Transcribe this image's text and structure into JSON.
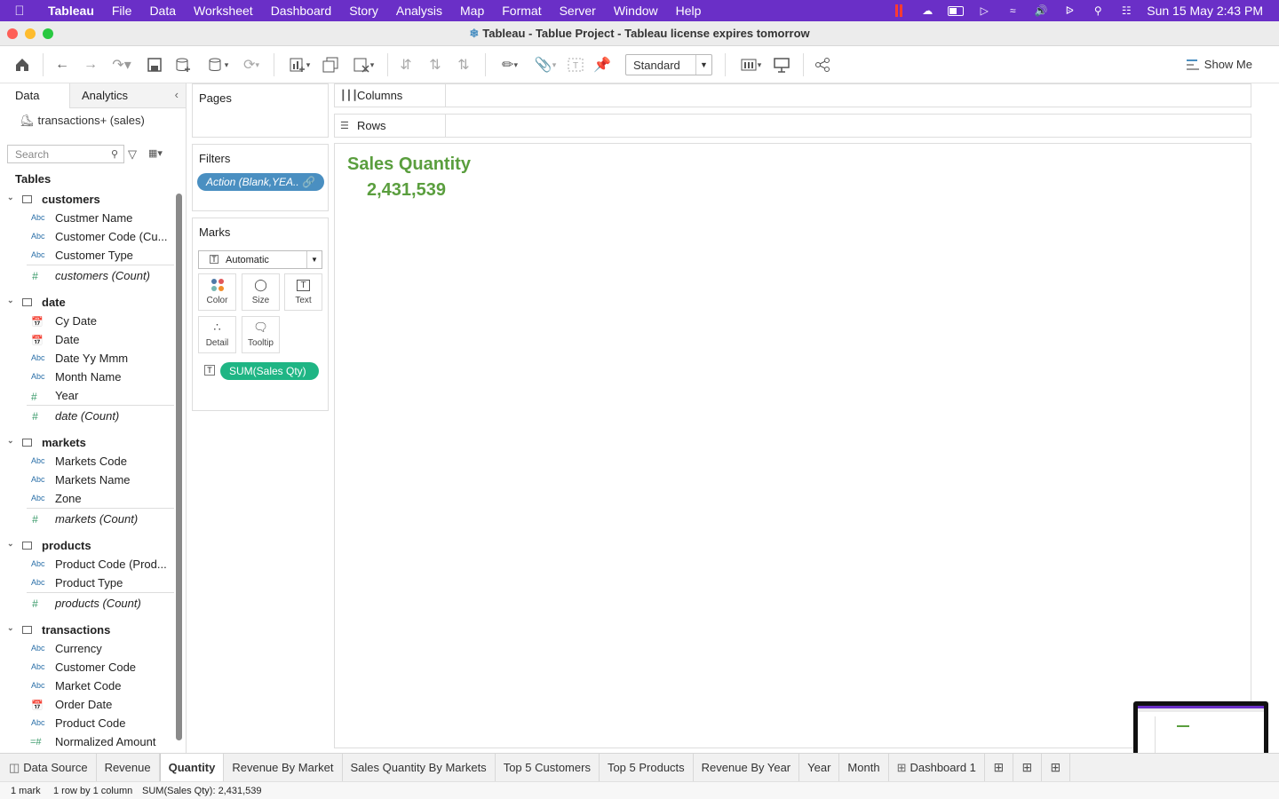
{
  "menubar": {
    "app": "Tableau",
    "items": [
      "File",
      "Data",
      "Worksheet",
      "Dashboard",
      "Story",
      "Analysis",
      "Map",
      "Format",
      "Server",
      "Window",
      "Help"
    ],
    "clock": "Sun 15 May  2:43 PM"
  },
  "window": {
    "title": "Tableau - Tablue Project - Tableau license expires tomorrow"
  },
  "toolbar": {
    "fit_mode": "Standard",
    "show_me": "Show Me"
  },
  "data_pane": {
    "tab_data": "Data",
    "tab_analytics": "Analytics",
    "datasource": "transactions+ (sales)",
    "search_placeholder": "Search",
    "tables_heading": "Tables"
  },
  "tables": [
    {
      "name": "customers",
      "fields": [
        {
          "type": "Abc",
          "name": "Custmer Name"
        },
        {
          "type": "Abc",
          "name": "Customer Code (Cu..."
        },
        {
          "type": "Abc",
          "name": "Customer Type"
        }
      ],
      "count": "customers (Count)"
    },
    {
      "name": "date",
      "fields": [
        {
          "type": "date",
          "name": "Cy Date"
        },
        {
          "type": "date",
          "name": "Date"
        },
        {
          "type": "Abc",
          "name": "Date Yy Mmm"
        },
        {
          "type": "Abc",
          "name": "Month Name"
        },
        {
          "type": "#",
          "name": "Year"
        }
      ],
      "count": "date (Count)"
    },
    {
      "name": "markets",
      "fields": [
        {
          "type": "Abc",
          "name": "Markets Code"
        },
        {
          "type": "Abc",
          "name": "Markets Name"
        },
        {
          "type": "Abc",
          "name": "Zone"
        }
      ],
      "count": "markets (Count)"
    },
    {
      "name": "products",
      "fields": [
        {
          "type": "Abc",
          "name": "Product Code (Prod..."
        },
        {
          "type": "Abc",
          "name": "Product Type"
        }
      ],
      "count": "products (Count)"
    },
    {
      "name": "transactions",
      "fields": [
        {
          "type": "Abc",
          "name": "Currency"
        },
        {
          "type": "Abc",
          "name": "Customer Code"
        },
        {
          "type": "Abc",
          "name": "Market Code"
        },
        {
          "type": "date",
          "name": "Order Date"
        },
        {
          "type": "Abc",
          "name": "Product Code"
        },
        {
          "type": "=#",
          "name": "Normalized Amount"
        }
      ]
    }
  ],
  "cards": {
    "pages": "Pages",
    "filters": "Filters",
    "filter_pill": "Action (Blank,YEA..",
    "marks": "Marks",
    "marks_type": "Automatic",
    "color": "Color",
    "size": "Size",
    "text": "Text",
    "detail": "Detail",
    "tooltip": "Tooltip",
    "sum_pill": "SUM(Sales Qty)"
  },
  "shelves": {
    "columns": "Columns",
    "rows": "Rows"
  },
  "view": {
    "title": "Sales Quantity",
    "value": "2,431,539",
    "accent": "#5a9e3e"
  },
  "sheet_tabs": [
    "Revenue",
    "Quantity",
    "Revenue By Market",
    "Sales Quantity By Markets",
    "Top 5 Customers",
    "Top 5 Products",
    "Revenue By Year",
    "Year",
    "Month",
    "Dashboard 1"
  ],
  "active_tab": "Quantity",
  "data_source_tab": "Data Source",
  "status": {
    "marks": "1 mark",
    "dims": "1 row by 1 column",
    "sum": "SUM(Sales Qty): 2,431,539"
  }
}
